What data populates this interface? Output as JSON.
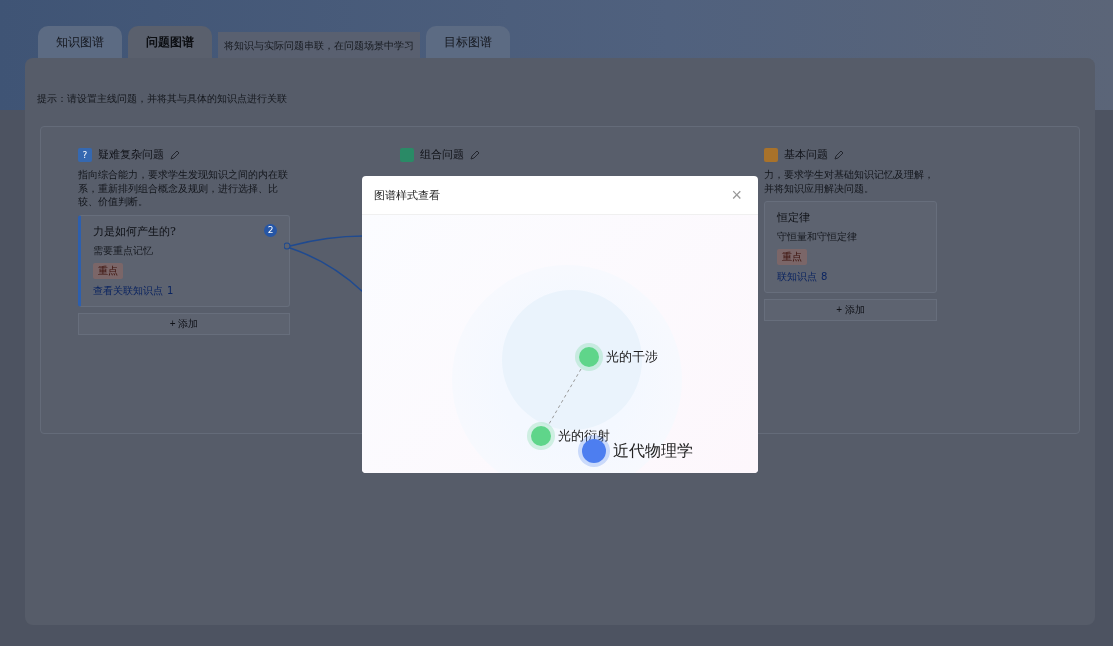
{
  "tabs": [
    {
      "kind": "tab",
      "label": "知识图谱",
      "selected": false
    },
    {
      "kind": "tab",
      "label": "问题图谱",
      "selected": true
    },
    {
      "kind": "hint",
      "label": "将知识与实际问题串联，在问题场景中学习",
      "selected": false
    },
    {
      "kind": "tab",
      "label": "目标图谱",
      "selected": false
    }
  ],
  "tip": "提示：请设置主线问题，并将其与具体的知识点进行关联",
  "columns": [
    {
      "badge_text": "?",
      "color": "#3568b0",
      "title": "疑难复杂问题",
      "description": "指向综合能力，要求学生发现知识之间的内在联系，重新排列组合概念及规则，进行选择、比较、价值判断。",
      "cards": [
        {
          "title": "力是如何产生的?",
          "note": "需要重点记忆",
          "tag": "重点",
          "link": "查看关联知识点",
          "count": "1",
          "badge": "2",
          "highlighted": true
        }
      ],
      "add_label": "+ 添加"
    },
    {
      "color": "#2a8a66",
      "title": "组合问题"
    },
    {
      "color": "#a8722a",
      "title": "基本问题",
      "description": "力，要求学生对基础知识记忆及理解，并将知识应用解决问题。",
      "cards": [
        {
          "title": "恒定律",
          "note": "守恒量和守恒定律",
          "tag": "重点",
          "link": "联知识点",
          "count": "8",
          "highlighted": false
        }
      ],
      "add_label": "+ 添加"
    }
  ],
  "modal": {
    "title": "图谱样式查看",
    "close": "×",
    "nodes": [
      {
        "label": "光的干涉",
        "kind": "leaf",
        "color": "#5fd58a"
      },
      {
        "label": "光的衍射",
        "kind": "leaf",
        "color": "#5fd58a"
      },
      {
        "label": "近代物理学",
        "kind": "root",
        "color": "#4d7ef0"
      }
    ]
  }
}
